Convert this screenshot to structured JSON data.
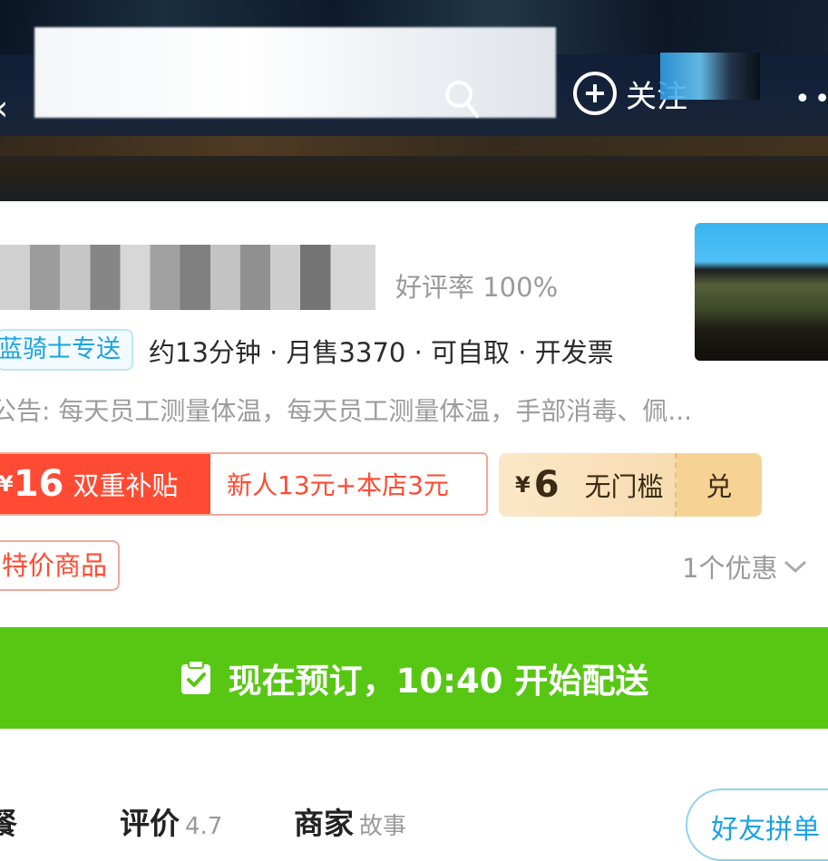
{
  "header": {
    "follow_label": "关注"
  },
  "shop": {
    "rating": "好评率 100%",
    "delivery_tag": "蓝骑士专送",
    "delivery_meta": "约13分钟 · 月售3370 · 可自取 · 开发票",
    "notice": "公告: 每天员工测量体温，每天员工测量体温，手部消毒、佩..."
  },
  "coupons": {
    "subsidy": {
      "symbol": "¥",
      "amount": "16",
      "label": "双重补贴",
      "detail": "新人13元+本店3元"
    },
    "voucher": {
      "symbol": "¥",
      "amount": "6",
      "label": "无门槛",
      "action": "兑"
    },
    "special_tag": "特价商品",
    "offer_count": "1个优惠"
  },
  "preorder": {
    "text": "现在预订，10:40 开始配送"
  },
  "tabs": [
    {
      "label": "餐"
    },
    {
      "label": "评价",
      "sub": "4.7"
    },
    {
      "label": "商家",
      "sub": "故事"
    }
  ],
  "group_button": "好友拼单",
  "colors": {
    "brand_blue": "#1ba3e2",
    "red": "#ff4b33",
    "green": "#57c714",
    "gold": "#f7d7a6"
  }
}
